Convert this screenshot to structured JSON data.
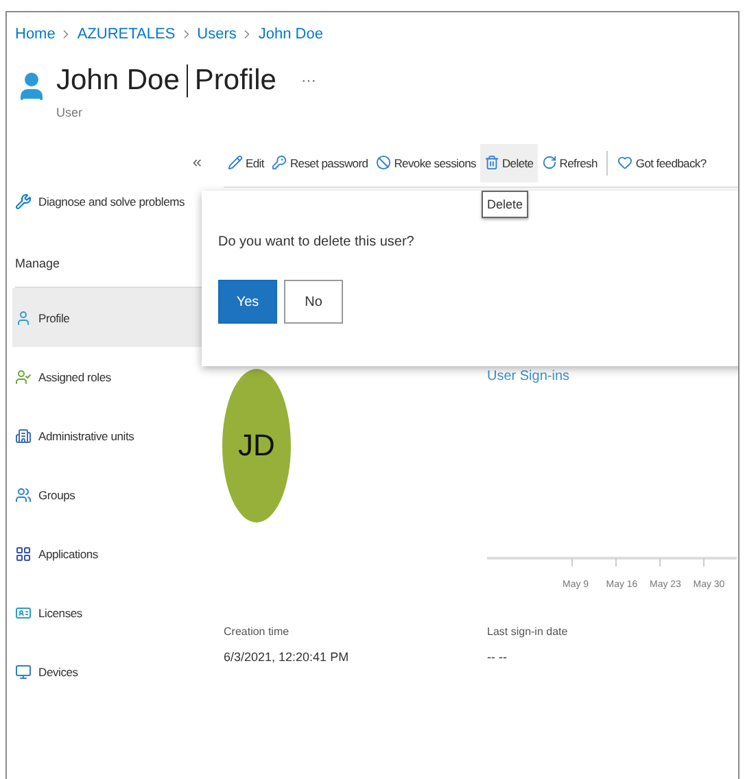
{
  "breadcrumb": [
    {
      "label": "Home"
    },
    {
      "label": "AZURETALES"
    },
    {
      "label": "Users"
    },
    {
      "label": "John Doe"
    }
  ],
  "header": {
    "title": "John Doe",
    "section": "Profile",
    "more": "···",
    "subtitle": "User"
  },
  "sidebar": {
    "collapse": "«",
    "top_items": [
      {
        "label": "Diagnose and solve problems",
        "selected": false
      }
    ],
    "section": "Manage",
    "items": [
      {
        "label": "Profile",
        "selected": true
      },
      {
        "label": "Assigned roles",
        "selected": false
      },
      {
        "label": "Administrative units",
        "selected": false
      },
      {
        "label": "Groups",
        "selected": false
      },
      {
        "label": "Applications",
        "selected": false
      },
      {
        "label": "Licenses",
        "selected": false
      },
      {
        "label": "Devices",
        "selected": false
      }
    ]
  },
  "toolbar": [
    {
      "label": "Edit",
      "hovered": false
    },
    {
      "label": "Reset password",
      "hovered": false
    },
    {
      "label": "Revoke sessions",
      "hovered": false
    },
    {
      "label": "Delete",
      "hovered": true
    },
    {
      "label": "Refresh",
      "hovered": false
    },
    {
      "label": "Got feedback?",
      "hovered": false
    }
  ],
  "tooltip": "Delete",
  "dialog": {
    "message": "Do you want to delete this user?",
    "buttons": [
      {
        "label": "Yes",
        "kind": "primary"
      },
      {
        "label": "No",
        "kind": "secondary"
      }
    ]
  },
  "profile": {
    "initials": "JD"
  },
  "signins": {
    "title": "User Sign-ins",
    "ticks": [
      "May 9",
      "May 16",
      "May 23",
      "May 30"
    ]
  },
  "fields": [
    {
      "label": "Creation time",
      "value": "6/3/2021, 12:20:41 PM"
    },
    {
      "label": "Last sign-in date",
      "value": "-- --"
    }
  ]
}
